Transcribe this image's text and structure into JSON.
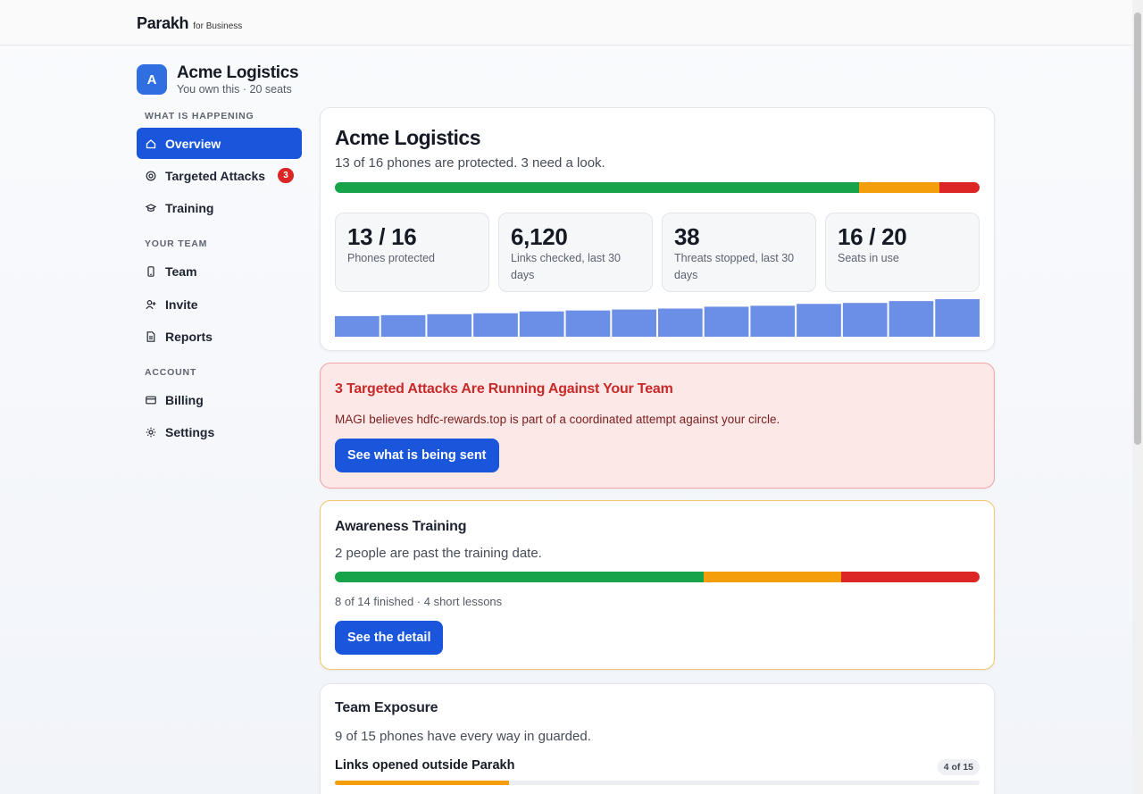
{
  "brand": {
    "name": "Parakh",
    "sub": "for Business"
  },
  "org": {
    "initial": "A",
    "name": "Acme Logistics",
    "meta": "You own this · 20 seats"
  },
  "nav": {
    "sections": [
      "WHAT IS HAPPENING",
      "YOUR TEAM",
      "ACCOUNT"
    ],
    "items": [
      {
        "label": "Overview",
        "icon": "home-icon",
        "active": true
      },
      {
        "label": "Targeted Attacks",
        "icon": "target-icon",
        "badge": "3"
      },
      {
        "label": "Training",
        "icon": "graduation-cap-icon"
      },
      {
        "label": "Team",
        "icon": "phone-icon"
      },
      {
        "label": "Invite",
        "icon": "user-plus-icon"
      },
      {
        "label": "Reports",
        "icon": "document-icon"
      },
      {
        "label": "Billing",
        "icon": "credit-card-icon"
      },
      {
        "label": "Settings",
        "icon": "gear-icon"
      }
    ]
  },
  "overview": {
    "title": "Acme Logistics",
    "subtitle": "13 of 16 phones are protected. 3 need a look.",
    "status_bar": {
      "protected": 13,
      "warning": 2,
      "danger": 1
    },
    "stats": [
      {
        "value": "13 / 16",
        "label": "Phones protected"
      },
      {
        "value": "6,120",
        "label": "Links checked, last 30 days"
      },
      {
        "value": "38",
        "label": "Threats stopped, last 30 days"
      },
      {
        "value": "16 / 20",
        "label": "Seats in use"
      }
    ],
    "trend": [
      22,
      23,
      24,
      25,
      27,
      28,
      29,
      30,
      32,
      33,
      35,
      36,
      38,
      40
    ]
  },
  "alert": {
    "title": "3 Targeted Attacks Are Running Against Your Team",
    "text": "MAGI believes hdfc-rewards.top is part of a coordinated attempt against your circle.",
    "button": "See what is being sent"
  },
  "training": {
    "title": "Awareness Training",
    "subtitle": "2 people are past the training date.",
    "bar": {
      "done": 8,
      "in_progress": 3,
      "overdue": 3
    },
    "progress_text": "8 of 14 finished · 4 short lessons",
    "button": "See the detail"
  },
  "exposure": {
    "title": "Team Exposure",
    "subtitle": "9 of 15 phones have every way in guarded.",
    "row_title": "Links opened outside Parakh",
    "row_pill": "4 of 15",
    "row_fraction": 0.27
  },
  "colors": {
    "accent": "#1a56db",
    "green": "#16a34a",
    "amber": "#f59e0b",
    "red": "#dc2626",
    "spark": "#6b8ee6"
  }
}
